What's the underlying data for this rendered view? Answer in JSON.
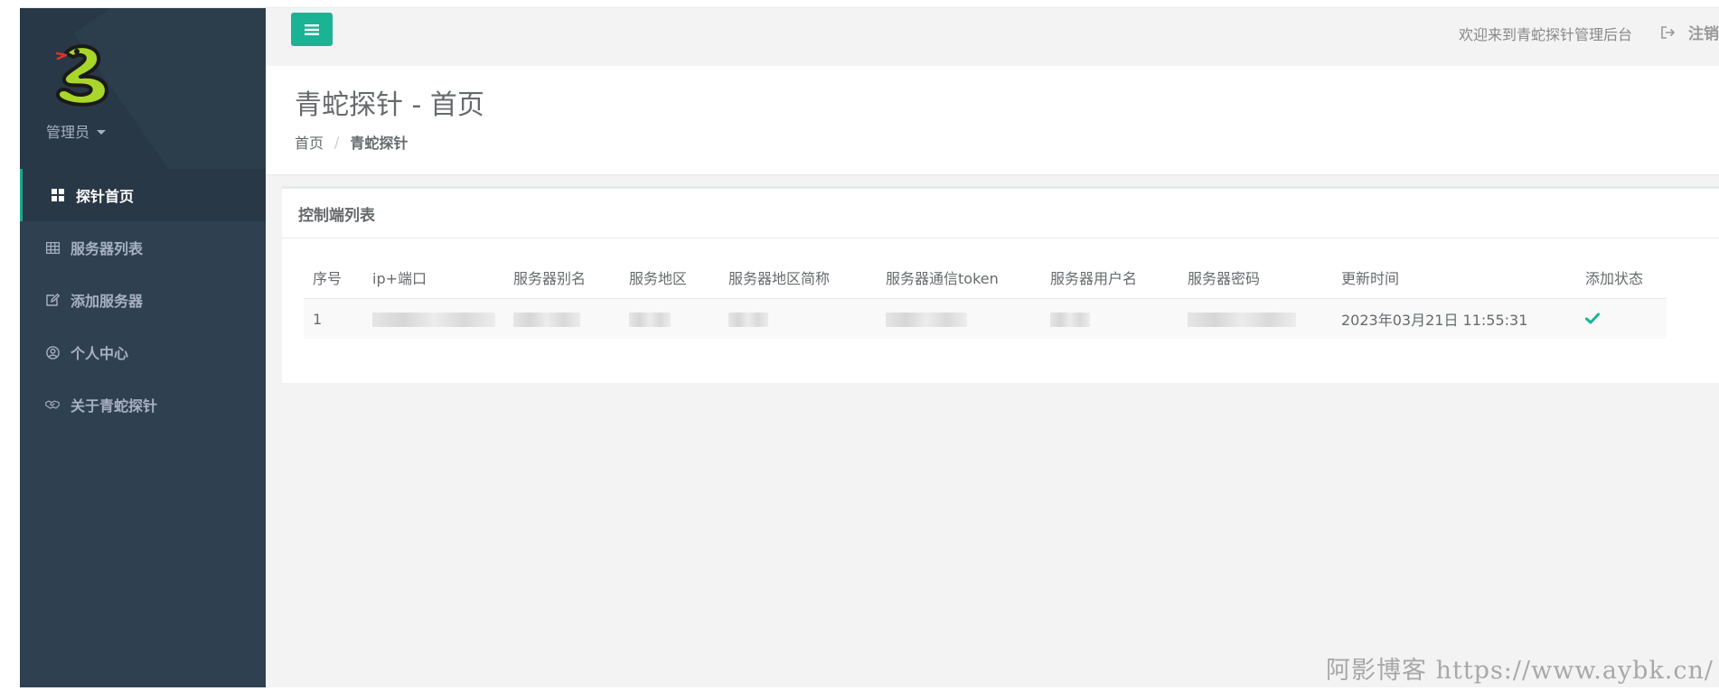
{
  "sidebar": {
    "admin_name": "管理员",
    "items": [
      {
        "label": "探针首页",
        "icon": "dashboard-icon",
        "active": true
      },
      {
        "label": "服务器列表",
        "icon": "table-icon"
      },
      {
        "label": "添加服务器",
        "icon": "edit-icon"
      },
      {
        "label": "个人中心",
        "icon": "user-circle-icon"
      },
      {
        "label": "关于青蛇探针",
        "icon": "handshake-icon"
      }
    ]
  },
  "topbar": {
    "welcome": "欢迎来到青蛇探针管理后台",
    "logout": "注销"
  },
  "page": {
    "title": "青蛇探针 - 首页",
    "breadcrumb": {
      "home": "首页",
      "separator": "/",
      "current": "青蛇探针"
    }
  },
  "panel": {
    "title": "控制端列表",
    "columns": [
      "序号",
      "ip+端口",
      "服务器别名",
      "服务地区",
      "服务器地区简称",
      "服务器通信token",
      "服务器用户名",
      "服务器密码",
      "更新时间",
      "添加状态"
    ],
    "rows": [
      {
        "index": "1",
        "updated": "2023年03月21日 11:55:31",
        "status": "check-icon"
      }
    ]
  },
  "watermark": "阿影博客 https://www.aybk.cn/",
  "colors": {
    "sidebar_bg": "#2f4050",
    "accent": "#1ab394",
    "page_bg": "#f3f3f4"
  }
}
